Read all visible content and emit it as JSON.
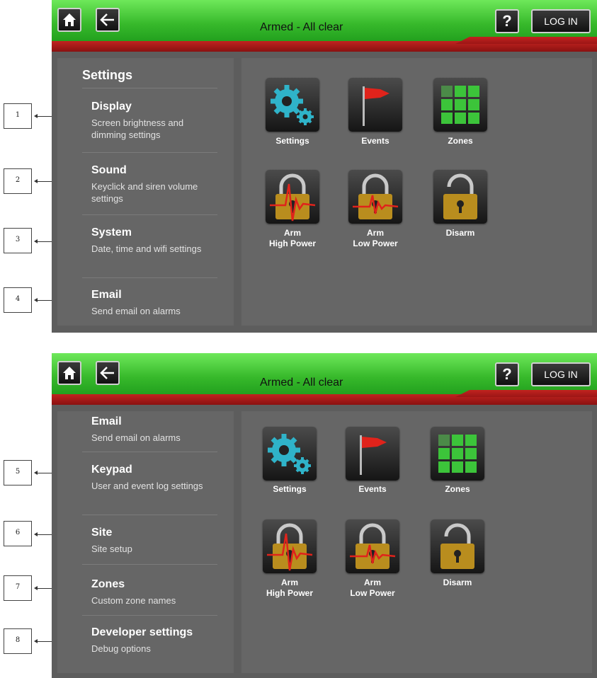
{
  "screens": [
    {
      "header": {
        "status": "Armed - All clear",
        "help_label": "?",
        "login_label": "LOG IN"
      },
      "panel_heading": "Settings",
      "menu": [
        {
          "title": "Display",
          "desc": "Screen brightness and dimming settings"
        },
        {
          "title": "Sound",
          "desc": "Keyclick and siren volume settings"
        },
        {
          "title": "System",
          "desc": "Date, time and wifi settings"
        },
        {
          "title": "Email",
          "desc": "Send email on alarms"
        }
      ],
      "tiles": [
        "Settings",
        "Events",
        "Zones",
        "Arm\nHigh Power",
        "Arm\nLow Power",
        "Disarm"
      ]
    },
    {
      "header": {
        "status": "Armed - All clear",
        "help_label": "?",
        "login_label": "LOG IN"
      },
      "menu": [
        {
          "title": "Email",
          "desc": "Send email on alarms"
        },
        {
          "title": "Keypad",
          "desc": "User and event log settings"
        },
        {
          "title": "Site",
          "desc": "Site setup"
        },
        {
          "title": "Zones",
          "desc": "Custom zone names"
        },
        {
          "title": "Developer settings",
          "desc": "Debug options"
        }
      ],
      "tiles": [
        "Settings",
        "Events",
        "Zones",
        "Arm\nHigh Power",
        "Arm\nLow Power",
        "Disarm"
      ]
    }
  ],
  "callouts": [
    "1",
    "2",
    "3",
    "4",
    "5",
    "6",
    "7",
    "8"
  ],
  "icons": {
    "home": "home-icon",
    "back": "back-arrow-icon",
    "settings": "gears-icon",
    "events": "flag-icon",
    "zones": "grid-icon",
    "arm_high": "padlock-high-power-icon",
    "arm_low": "padlock-low-power-icon",
    "disarm": "padlock-open-icon"
  },
  "colors": {
    "header_green": "#37b92b",
    "header_red": "#b51d1a",
    "panel_bg": "#666666",
    "zone_green": "#3cc43a",
    "gear_teal": "#2fb3c9",
    "lock_gold": "#b98d1e",
    "wave_red": "#e0231b"
  }
}
